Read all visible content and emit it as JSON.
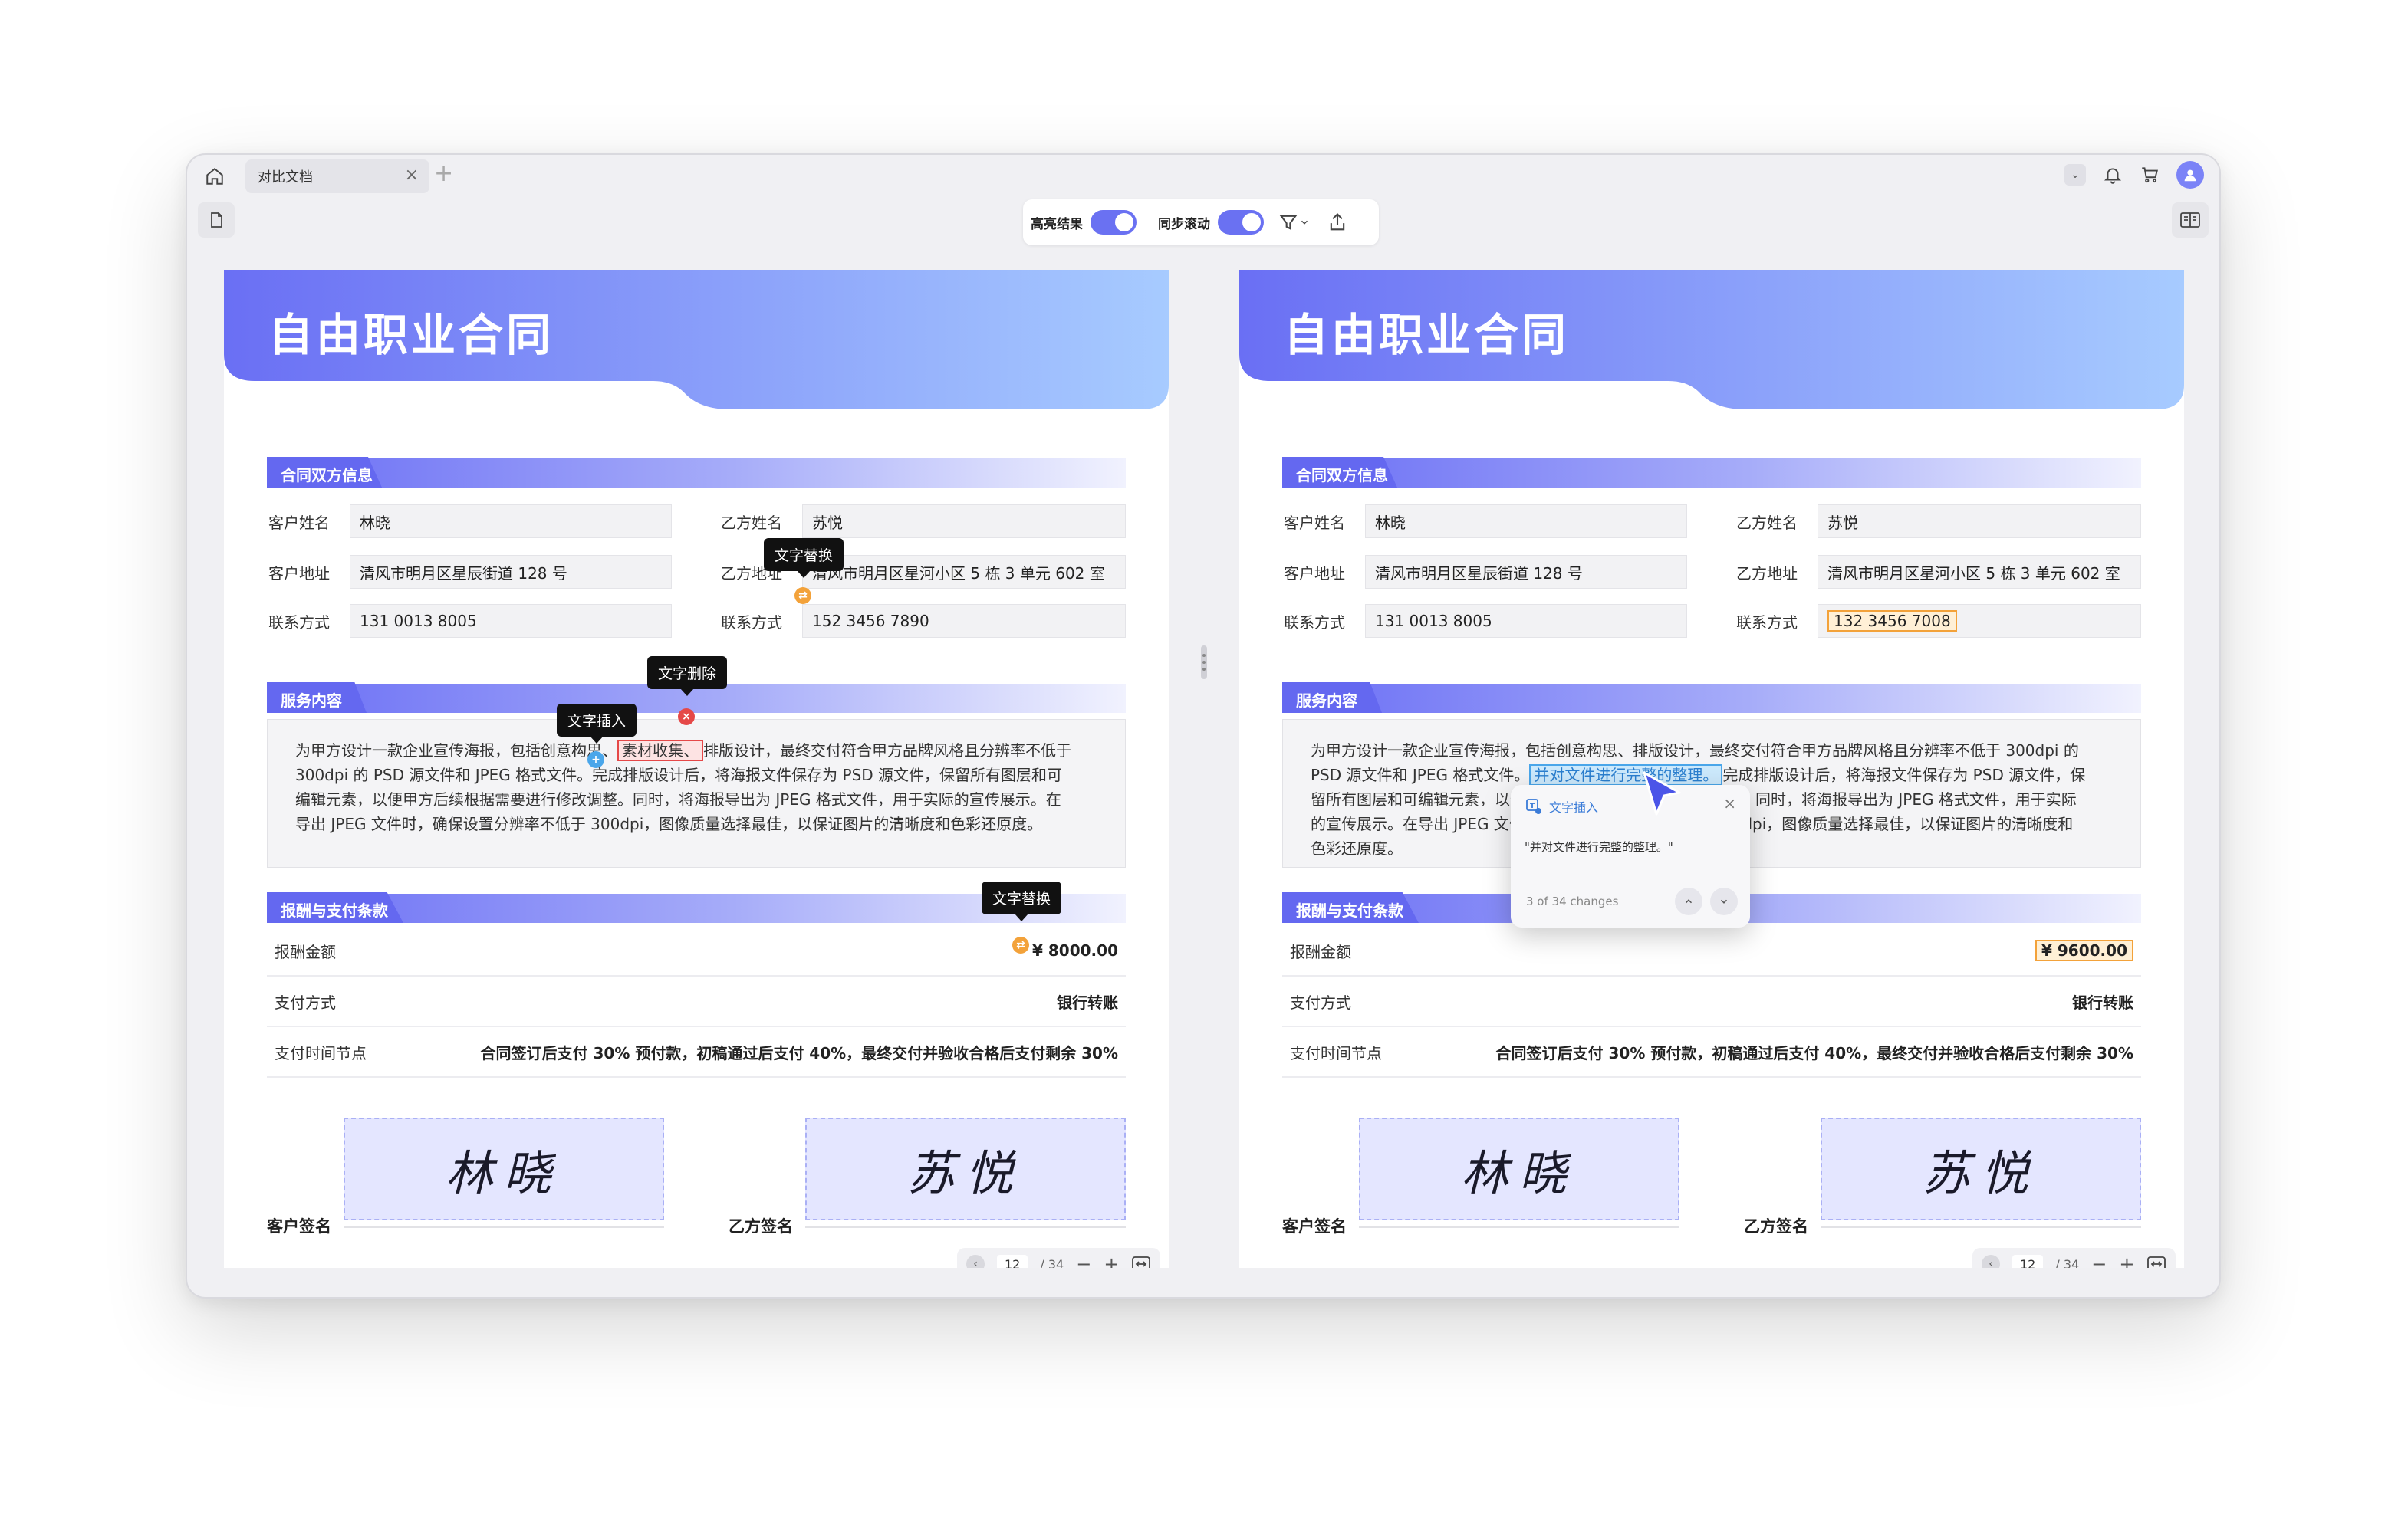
{
  "tabbar": {
    "tab_title": "对比文档",
    "close_glyph": "×",
    "add_glyph": "+",
    "dropdown_glyph": "⌄"
  },
  "toolbar": {
    "highlight_label": "高亮结果",
    "sync_scroll_label": "同步滚动",
    "highlight_on": true,
    "sync_scroll_on": true
  },
  "colors": {
    "accent": "#6a71f2",
    "insert_blue": "#4aa6ea",
    "delete_red": "#e54848",
    "replace_orange": "#f3a23a"
  },
  "left_doc": {
    "title": "自由职业合同",
    "section_parties": "合同双方信息",
    "client_name_label": "客户姓名",
    "client_name": "林晓",
    "client_addr_label": "客户地址",
    "client_addr": "清风市明月区星辰街道 128 号",
    "client_phone_label": "联系方式",
    "client_phone": "131 0013 8005",
    "party_b_name_label": "乙方姓名",
    "party_b_name": "苏悦",
    "party_b_addr_label": "乙方地址",
    "party_b_addr": "清风市明月区星河小区 5 栋 3 单元 602 室",
    "party_b_phone_label": "联系方式",
    "party_b_phone": "152 3456 7890",
    "section_service": "服务内容",
    "service_a": "为甲方设计一款企业宣传海报，包括创意构思、",
    "service_deleted": "素材收集、",
    "service_b": "排版设计，最终交付符合甲方品牌风格且分辨率不低于",
    "service_c": "300dpi 的 PSD 源文件和 JPEG 格式文件。完成排版设计后，将海报文件保存为 PSD 源文件，保留所有图层和可",
    "service_d": "编辑元素，以便甲方后续根据需要进行修改调整。同时，将海报导出为 JPEG 格式文件，用于实际的宣传展示。在",
    "service_e": "导出 JPEG 文件时，确保设置分辨率不低于 300dpi，图像质量选择最佳，以保证图片的清晰度和色彩还原度。",
    "section_payment": "报酬与支付条款",
    "pay_amount_label": "报酬金额",
    "pay_amount": "¥ 8000.00",
    "pay_method_label": "支付方式",
    "pay_method": "银行转账",
    "pay_schedule_label": "支付时间节点",
    "pay_schedule": "合同签订后支付 30% 预付款，初稿通过后支付 40%，最终交付并验收合格后支付剩余 30%",
    "client_sign_label": "客户签名",
    "client_sign": "林晓",
    "party_b_sign_label": "乙方签名",
    "party_b_sign": "苏悦",
    "pager_page": "12",
    "pager_total": "/ 34"
  },
  "markers": {
    "replace": "文字替换",
    "insert": "文字插入",
    "delete": "文字删除"
  },
  "right_doc": {
    "title": "自由职业合同",
    "section_parties": "合同双方信息",
    "client_name_label": "客户姓名",
    "client_name": "林晓",
    "client_addr_label": "客户地址",
    "client_addr": "清风市明月区星辰街道 128 号",
    "client_phone_label": "联系方式",
    "client_phone": "131 0013 8005",
    "party_b_name_label": "乙方姓名",
    "party_b_name": "苏悦",
    "party_b_addr_label": "乙方地址",
    "party_b_addr": "清风市明月区星河小区 5 栋 3 单元 602 室",
    "party_b_phone_label": "联系方式",
    "party_b_phone": "132 3456 7008",
    "section_service": "服务内容",
    "service_a": "为甲方设计一款企业宣传海报，包括创意构思、排版设计，最终交付符合甲方品牌风格且分辨率不低于 300dpi 的",
    "service_b": "PSD 源文件和 JPEG 格式文件。",
    "service_inserted": "并对文件进行完整的整理。",
    "service_c": "完成排版设计后，将海报文件保存为 PSD 源文件，保",
    "service_d": "留所有图层和可编辑元素，以便甲方后续根据需要进行修改调整。同时，将海报导出为 JPEG 格式文件，用于实际",
    "service_e": "的宣传展示。在导出 JPEG 文件时，确保设置分辨率不低于 300dpi，图像质量选择最佳，以保证图片的清晰度和",
    "service_f": "色彩还原度。",
    "section_payment": "报酬与支付条款",
    "pay_amount_label": "报酬金额",
    "pay_amount": "¥ 9600.00",
    "pay_method_label": "支付方式",
    "pay_method": "银行转账",
    "pay_schedule_label": "支付时间节点",
    "pay_schedule": "合同签订后支付 30% 预付款，初稿通过后支付 40%，最终交付并验收合格后支付剩余 30%",
    "client_sign_label": "客户签名",
    "client_sign": "林晓",
    "party_b_sign_label": "乙方签名",
    "party_b_sign": "苏悦",
    "pager_page": "12",
    "pager_total": "/ 34"
  },
  "popup": {
    "title": "文字插入",
    "content": "\"并对文件进行完整的整理。\"",
    "counter": "3 of 34 changes",
    "close_glyph": "×"
  },
  "pager_minus": "−",
  "pager_plus": "+"
}
